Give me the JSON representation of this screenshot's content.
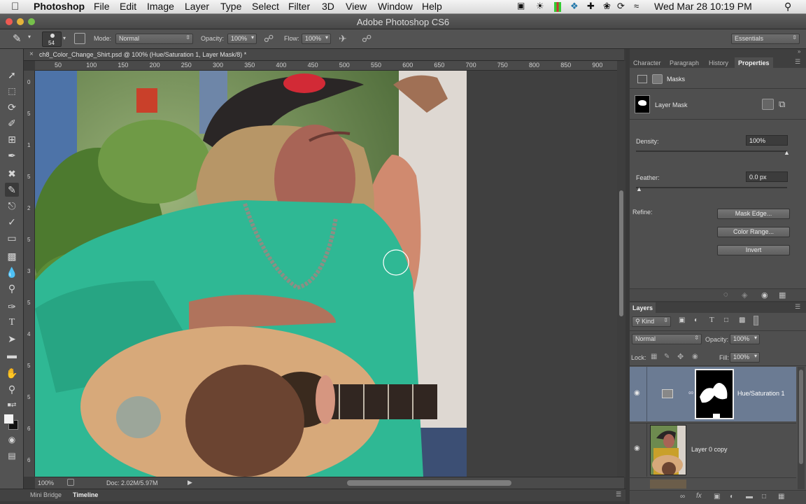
{
  "menubar": {
    "app": "Photoshop",
    "items": [
      "File",
      "Edit",
      "Image",
      "Layer",
      "Type",
      "Select",
      "Filter",
      "3D",
      "View",
      "Window",
      "Help"
    ],
    "clock": "Wed Mar 28  10:19 PM"
  },
  "window": {
    "title": "Adobe Photoshop CS6"
  },
  "options": {
    "brush_size": "54",
    "mode_label": "Mode:",
    "mode_value": "Normal",
    "opacity_label": "Opacity:",
    "opacity_value": "100%",
    "flow_label": "Flow:",
    "flow_value": "100%",
    "workspace": "Essentials"
  },
  "document": {
    "tab_title": "ch8_Color_Change_Shirt.psd @ 100% (Hue/Saturation 1, Layer Mask/8) *",
    "ruler_h": [
      "50",
      "100",
      "150",
      "200",
      "250",
      "300",
      "350",
      "400",
      "450",
      "500",
      "550",
      "600",
      "650",
      "700",
      "750",
      "800",
      "850",
      "900"
    ],
    "ruler_v": [
      "0",
      "5",
      "1",
      "5",
      "2",
      "5",
      "3",
      "5",
      "4",
      "5",
      "5",
      "6",
      "6"
    ],
    "zoom": "100%",
    "doc_size": "Doc: 2.02M/5.97M"
  },
  "bottom_tabs": [
    "Mini Bridge",
    "Timeline"
  ],
  "properties": {
    "tabs": [
      "Character",
      "Paragraph",
      "History",
      "Properties"
    ],
    "section": "Masks",
    "mask_name": "Layer Mask",
    "density_label": "Density:",
    "density_value": "100%",
    "density_level": 1.0,
    "feather_label": "Feather:",
    "feather_value": "0.0 px",
    "feather_level": 0.0,
    "refine_label": "Refine:",
    "buttons": [
      "Mask Edge...",
      "Color Range...",
      "Invert"
    ]
  },
  "layers": {
    "title": "Layers",
    "filter_kind": "Kind",
    "blend_mode": "Normal",
    "opacity_label": "Opacity:",
    "opacity_value": "100%",
    "lock_label": "Lock:",
    "fill_label": "Fill:",
    "fill_value": "100%",
    "items": [
      {
        "name": "Hue/Saturation 1"
      },
      {
        "name": "Layer 0 copy"
      }
    ]
  },
  "colors": {
    "shirt": "#2fb894",
    "selected_layer": "#6b7b93",
    "accent": "#e8e8e8"
  }
}
